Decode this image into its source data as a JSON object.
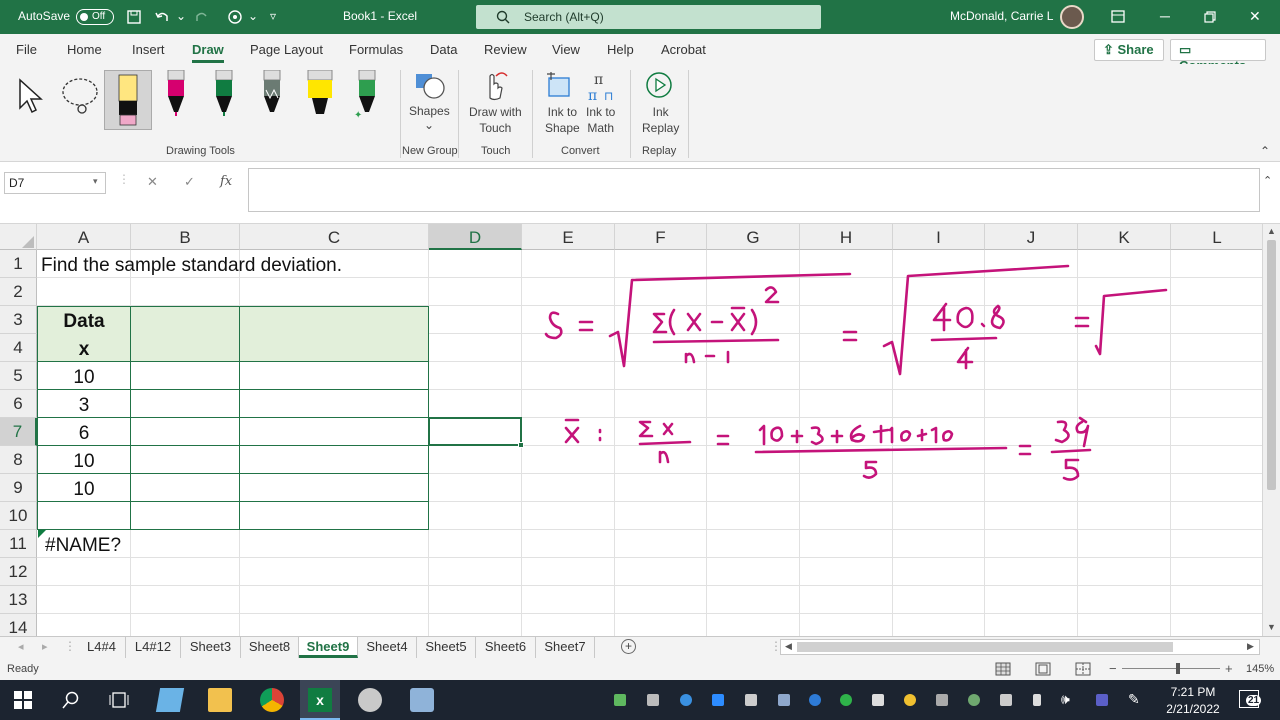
{
  "titlebar": {
    "autosave_label": "AutoSave",
    "autosave_state": "Off",
    "doc_title": "Book1 - Excel",
    "search_placeholder": "Search (Alt+Q)",
    "user_name": "McDonald, Carrie L"
  },
  "menu": {
    "tabs": [
      "File",
      "Home",
      "Insert",
      "Draw",
      "Page Layout",
      "Formulas",
      "Data",
      "Review",
      "View",
      "Help",
      "Acrobat"
    ],
    "active_tab": "Draw",
    "share_label": "Share",
    "comments_label": "Comments"
  },
  "ribbon": {
    "drawing_tools_label": "Drawing Tools",
    "shapes_label": "Shapes",
    "new_group_label": "New Group",
    "draw_with_touch_label": "Draw with\nTouch",
    "touch_label": "Touch",
    "ink_to_shape_label": "Ink to\nShape",
    "ink_to_math_label": "Ink to\nMath",
    "convert_label": "Convert",
    "ink_replay_label": "Ink\nReplay",
    "replay_label": "Replay",
    "pen_colors": [
      "#000000",
      "#d6006f",
      "#107c41",
      "#6b6b6b",
      "#ffe600",
      "#2e9e4f"
    ]
  },
  "formula_bar": {
    "name_box": "D7",
    "cancel": "✕",
    "enter": "✓",
    "fx": "fx",
    "formula": ""
  },
  "sheet": {
    "columns": [
      "A",
      "B",
      "C",
      "D",
      "E",
      "F",
      "G",
      "H",
      "I",
      "J",
      "K",
      "L"
    ],
    "selected_column": "D",
    "rows": [
      "1",
      "2",
      "3",
      "4",
      "5",
      "6",
      "7",
      "8",
      "9",
      "10",
      "11",
      "12",
      "13",
      "14"
    ],
    "selected_row": "7",
    "cells": {
      "A1": "Find the sample standard deviation.",
      "A3": "Data",
      "A4": "x",
      "A5": "10",
      "A6": "3",
      "A7": "6",
      "A8": "10",
      "A9": "10",
      "A11": "#NAME?"
    },
    "header_fill": "#e2efda",
    "border_color": "#217346"
  },
  "tabs": {
    "sheets": [
      "L4#4",
      "L4#12",
      "Sheet3",
      "Sheet8",
      "Sheet9",
      "Sheet4",
      "Sheet5",
      "Sheet6",
      "Sheet7"
    ],
    "active": "Sheet9",
    "add": "+"
  },
  "status": {
    "ready": "Ready",
    "zoom": "145%"
  },
  "taskbar": {
    "time": "7:21 PM",
    "date": "2/21/2022",
    "notifications": "21"
  },
  "ink": {
    "s_formula": "s = √( Σ(x − x̄)² / (n−1) ) = √( 40.8 / 4 ) = √",
    "mean_formula": "x̄ : Σx / n = (10+3+6+10+10) / 5 = 39/5",
    "numerator": "40.8",
    "denominator": "4",
    "sum_expr": "10+3+6+10+10",
    "divisor": "5",
    "result_num": "39",
    "result_den": "5",
    "color": "#c4137a"
  }
}
